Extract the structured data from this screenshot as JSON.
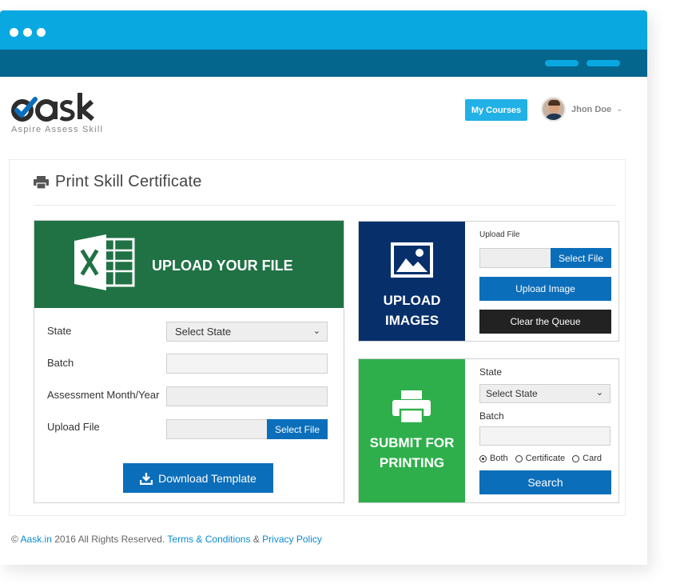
{
  "window": {
    "titlebar_color": "#0aa8e0",
    "navbar_color": "#04668d"
  },
  "header": {
    "logo_text": "aask",
    "logo_tagline": "Aspire Assess Skill",
    "my_courses_label": "My Courses",
    "user_name": "Jhon Doe"
  },
  "page": {
    "title": "Print Skill Certificate",
    "title_icon": "printer-icon"
  },
  "upload_file": {
    "heading": "UPLOAD YOUR FILE",
    "icon": "excel-icon",
    "header_color": "#207245",
    "state_label": "State",
    "state_value": "Select State",
    "batch_label": "Batch",
    "batch_value": "",
    "assessment_label": "Assessment Month/Year",
    "assessment_value": "",
    "upload_label": "Upload File",
    "upload_value": "",
    "select_file_label": "Select File",
    "download_label": "Download Template"
  },
  "upload_images": {
    "heading_line1": "UPLOAD",
    "heading_line2": "IMAGES",
    "icon": "image-icon",
    "color": "#07306b",
    "upload_file_label": "Upload File",
    "upload_value": "",
    "select_file_label": "Select File",
    "upload_image_label": "Upload Image",
    "clear_queue_label": "Clear the Queue"
  },
  "submit_printing": {
    "heading_line1": "SUBMIT FOR",
    "heading_line2": "PRINTING",
    "icon": "printer-icon",
    "color": "#2eaf4b",
    "state_label": "State",
    "state_value": "Select State",
    "batch_label": "Batch",
    "batch_value": "",
    "radio_both": "Both",
    "radio_certificate": "Certificate",
    "radio_card": "Card",
    "selected_radio": "Both",
    "search_label": "Search"
  },
  "footer": {
    "prefix": "©",
    "site_link": "Aask.in",
    "rights_text": "2016 All Rights Reserved.",
    "terms_link": "Terms & Conditions",
    "amp": "&",
    "privacy_link": "Privacy Policy"
  }
}
